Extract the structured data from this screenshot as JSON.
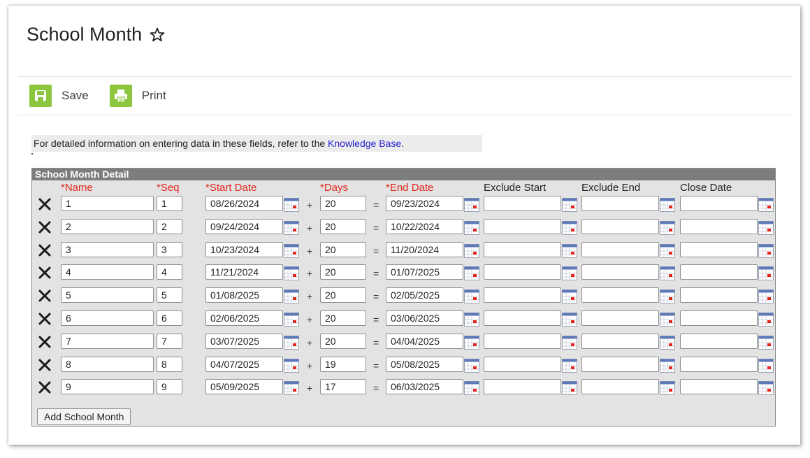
{
  "page": {
    "title": "School Month",
    "accent_color": "#8cc63f",
    "required_color": "#e2261c",
    "link_color": "#2a1fd0"
  },
  "toolbar": {
    "save_label": "Save",
    "print_label": "Print"
  },
  "info": {
    "text": "For detailed information on entering data in these fields, refer to the ",
    "link": "Knowledge Base",
    "suffix": "."
  },
  "panel": {
    "title": "School Month Detail",
    "add_button": "Add School Month",
    "headers": {
      "name": "*Name",
      "seq": "*Seq",
      "start_date": "*Start Date",
      "days": "*Days",
      "end_date": "*End Date",
      "exclude_start": "Exclude Start",
      "exclude_end": "Exclude End",
      "close_date": "Close Date"
    },
    "operators": {
      "plus": "+",
      "equals": "="
    },
    "rows": [
      {
        "name": "1",
        "seq": "1",
        "start": "08/26/2024",
        "days": "20",
        "end": "09/23/2024",
        "exclude_start": "",
        "exclude_end": "",
        "close": ""
      },
      {
        "name": "2",
        "seq": "2",
        "start": "09/24/2024",
        "days": "20",
        "end": "10/22/2024",
        "exclude_start": "",
        "exclude_end": "",
        "close": ""
      },
      {
        "name": "3",
        "seq": "3",
        "start": "10/23/2024",
        "days": "20",
        "end": "11/20/2024",
        "exclude_start": "",
        "exclude_end": "",
        "close": ""
      },
      {
        "name": "4",
        "seq": "4",
        "start": "11/21/2024",
        "days": "20",
        "end": "01/07/2025",
        "exclude_start": "",
        "exclude_end": "",
        "close": ""
      },
      {
        "name": "5",
        "seq": "5",
        "start": "01/08/2025",
        "days": "20",
        "end": "02/05/2025",
        "exclude_start": "",
        "exclude_end": "",
        "close": ""
      },
      {
        "name": "6",
        "seq": "6",
        "start": "02/06/2025",
        "days": "20",
        "end": "03/06/2025",
        "exclude_start": "",
        "exclude_end": "",
        "close": ""
      },
      {
        "name": "7",
        "seq": "7",
        "start": "03/07/2025",
        "days": "20",
        "end": "04/04/2025",
        "exclude_start": "",
        "exclude_end": "",
        "close": ""
      },
      {
        "name": "8",
        "seq": "8",
        "start": "04/07/2025",
        "days": "19",
        "end": "05/08/2025",
        "exclude_start": "",
        "exclude_end": "",
        "close": ""
      },
      {
        "name": "9",
        "seq": "9",
        "start": "05/09/2025",
        "days": "17",
        "end": "06/03/2025",
        "exclude_start": "",
        "exclude_end": "",
        "close": ""
      }
    ]
  }
}
